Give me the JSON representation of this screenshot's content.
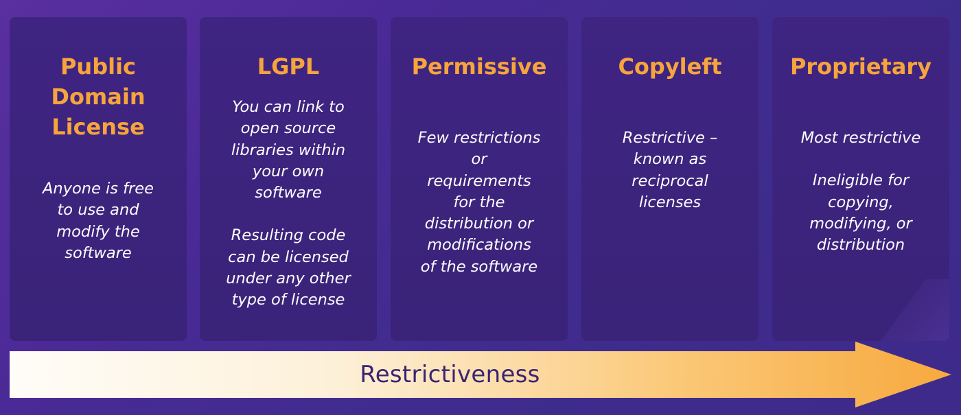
{
  "panels": [
    {
      "title_lines": [
        "Public",
        "Domain",
        "License"
      ],
      "paragraphs": [
        [
          "Anyone is free",
          "to use and",
          "modify the",
          "software"
        ]
      ]
    },
    {
      "title_lines": [
        "LGPL"
      ],
      "paragraphs": [
        [
          "You can link to",
          "open source",
          "libraries within",
          "your own",
          "software"
        ],
        [
          "Resulting code",
          "can be licensed",
          "under any other",
          "type of license"
        ]
      ]
    },
    {
      "title_lines": [
        "Permissive"
      ],
      "paragraphs": [
        [
          "Few restrictions",
          "or",
          "requirements",
          "for the",
          "distribution or",
          "modifications",
          "of the software"
        ]
      ]
    },
    {
      "title_lines": [
        "Copyleft"
      ],
      "paragraphs": [
        [
          "Restrictive –",
          "known as",
          "reciprocal",
          "licenses"
        ]
      ]
    },
    {
      "title_lines": [
        "Proprietary"
      ],
      "paragraphs": [
        [
          "Most restrictive"
        ],
        [
          "Ineligible for",
          "copying,",
          "modifying, or",
          "distribution"
        ]
      ]
    }
  ],
  "arrow": {
    "label": "Restrictiveness",
    "gradient_start": "#fffdf8",
    "gradient_end": "#f7a93e"
  },
  "colors": {
    "background": "#4a2a96",
    "panel": "#3d2380",
    "title": "#f6a43c",
    "text": "#ffffff",
    "arrow_label": "#3a2572"
  }
}
